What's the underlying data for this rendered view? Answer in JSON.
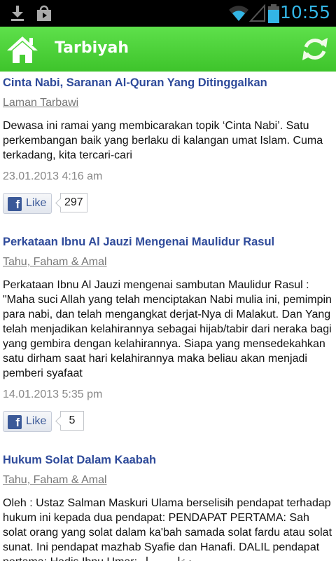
{
  "status_bar": {
    "time": "10:55",
    "icons": [
      "download-icon",
      "shopping-bag-icon",
      "wifi-icon",
      "signal-icon",
      "battery-icon"
    ],
    "time_color": "#33b5e5"
  },
  "action_bar": {
    "title": "Tarbiyah",
    "home_icon": "home-icon",
    "refresh_icon": "refresh-icon",
    "background": "#4cd13a"
  },
  "articles": [
    {
      "title": "Cinta Nabi, Saranan Al-Quran Yang Ditinggalkan",
      "category": "Laman Tarbawi",
      "excerpt": "Dewasa ini ramai yang membicarakan topik ‘Cinta Nabi’. Satu perkembangan baik yang berlaku di kalangan umat Islam. Cuma terkadang, kita tercari-cari",
      "date": "23.01.2013 4:16 am",
      "like_label": "Like",
      "like_count": "297"
    },
    {
      "title": "Perkataan Ibnu Al Jauzi Mengenai Maulidur Rasul",
      "category": "Tahu, Faham & Amal",
      "excerpt": "Perkataan Ibnu Al Jauzi mengenai sambutan Maulidur Rasul : \"Maha suci Allah yang telah menciptakan Nabi mulia ini, pemimpin para nabi, dan telah mengangkat derjat-Nya di Malakut. Dan Yang telah menjadikan kelahirannya sebagai hijab/tabir dari neraka bagi yang gembira dengan kelahirannya. Siapa yang mensedekahkan satu dirham saat hari kelahirannya maka beliau akan menjadi pemberi syafaat",
      "date": "14.01.2013 5:35 pm",
      "like_label": "Like",
      "like_count": "5"
    },
    {
      "title": "Hukum Solat Dalam Kaabah",
      "category": "Tahu, Faham & Amal",
      "excerpt": "Oleh : Ustaz Salman Maskuri Ulama berselisih pendapat terhadap hukum ini kepada dua pendapat: PENDAPAT PERTAMA: Sah solat orang yang solat dalam ka'bah samada solat fardu atau solat sunat. Ini pendapat mazhab Syafie dan Hanafi. DALIL pendapat pertama: Hadis Ibnu Umar: دخل رسول",
      "date": "",
      "like_label": "",
      "like_count": ""
    }
  ]
}
